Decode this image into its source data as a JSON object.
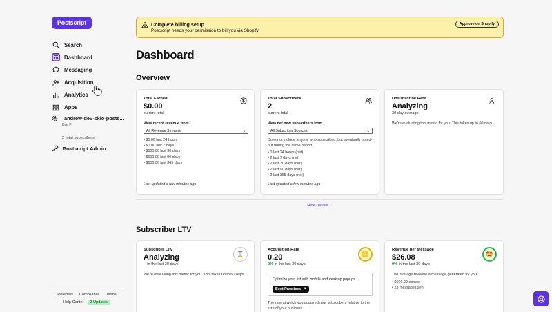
{
  "sidebar": {
    "logo": "Postscript",
    "items": [
      {
        "label": "Search",
        "icon": "search-icon"
      },
      {
        "label": "Dashboard",
        "icon": "dashboard-icon",
        "active": true
      },
      {
        "label": "Messaging",
        "icon": "message-icon"
      },
      {
        "label": "Acquisition",
        "icon": "acquisition-icon"
      },
      {
        "label": "Analytics",
        "icon": "bar-chart-icon"
      },
      {
        "label": "Apps",
        "icon": "apps-icon"
      }
    ],
    "shop_name": "andrew-dev-skio-posts...",
    "shop_user": "Bre F",
    "subscriber_count": "2 total subscribers",
    "admin_label": "Postscript Admin",
    "footer": {
      "referrals": "Referrals",
      "compliance": "Compliance",
      "terms": "Terms",
      "help_center": "Help Center",
      "updates_badge": "2 Updates!"
    }
  },
  "banner": {
    "title": "Complete billing setup",
    "text": "Postscript needs your permission to bill you via Shopify.",
    "button": "Approve on Shopify"
  },
  "page_title": "Dashboard",
  "overview": {
    "heading": "Overview",
    "cards": [
      {
        "title": "Total Earned",
        "value": "$0.00",
        "sub": "current total",
        "select_label": "View recent revenue from",
        "select_value": "All Revenue Streams",
        "items": [
          "$0.00 last 24 hours",
          "$0.00 last 7 days",
          "$600.00 last 30 days",
          "$600.00 last 90 days",
          "$600.00 last 365 days"
        ],
        "updated": "Last updated a few minutes ago"
      },
      {
        "title": "Total Subscribers",
        "value": "2",
        "sub": "current total",
        "select_label": "View net new subscribers from",
        "select_value": "All Subscriber Sources",
        "note": "Does not include anyone who subscribed, but eventually opted-out during the same period.",
        "items": [
          "0 last 24 hours (net)",
          "2 last 7 days (net)",
          "2 last 30 days (net)",
          "2 last 90 days (net)",
          "2 last 365 days (net)"
        ],
        "updated": "Last updated a few minutes ago"
      },
      {
        "title": "Unsubscribe Rate",
        "value": "Analyzing",
        "sub": "30 day average",
        "note": "We're evaluating this metric for you. This takes up to 60 days."
      }
    ],
    "hide_details": "Hide Details"
  },
  "ltv": {
    "heading": "Subscriber LTV",
    "cards": [
      {
        "title": "Subscriber LTV",
        "value": "Analyzing",
        "sub": "-- in the last 30 days",
        "note": "We're evaluating this metric for you. This takes up to 60 days."
      },
      {
        "title": "Acquisition Rate",
        "value": "0.20",
        "sub_pct": "0%",
        "sub": "in the last 30 days",
        "box_text": "Optimize your list with mobile and desktop popups.",
        "box_button": "Best Practices",
        "note": "The rate at which you acquired new subscribers relative to the size of your business."
      },
      {
        "title": "Revenue per Message",
        "value": "$26.08",
        "sub_pct": "0%",
        "sub": "in the last 30 days",
        "note": "The average revenue a message generated for you.",
        "items": [
          "$600.00 earned",
          "23 messages sent"
        ]
      }
    ]
  },
  "colors": {
    "brand": "#5b34e0",
    "banner_bg": "#fdf0a8",
    "positive": "#0a8a3a"
  }
}
